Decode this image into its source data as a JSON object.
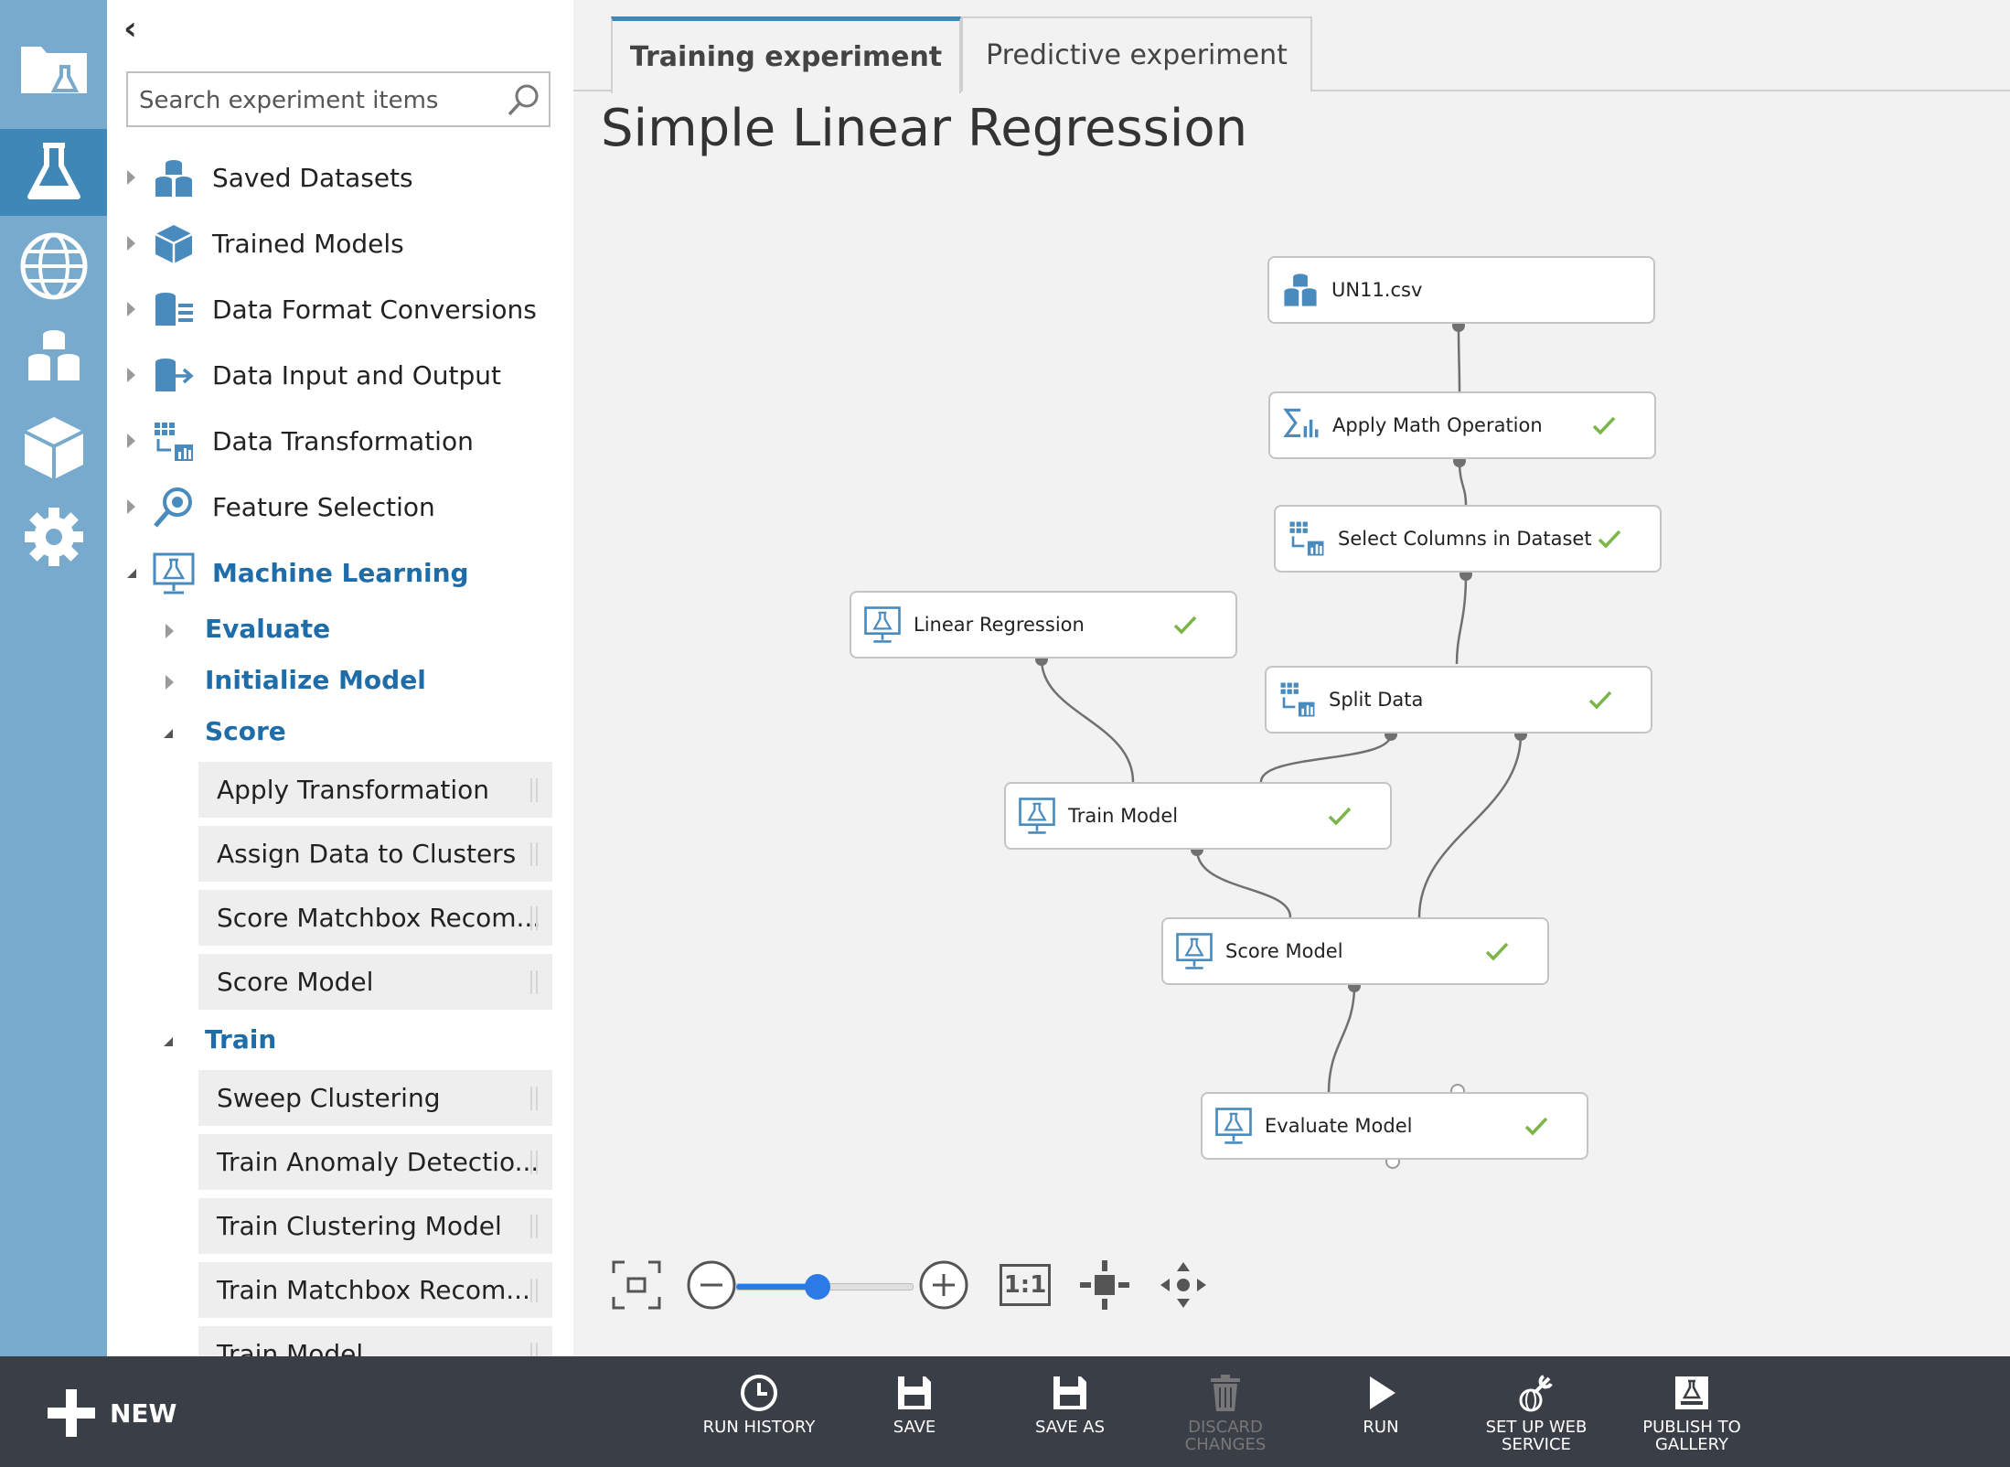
{
  "palette": {
    "collapse_glyph": "‹",
    "search": {
      "placeholder": "Search experiment items"
    },
    "categories": [
      {
        "label": "Saved Datasets",
        "icon": "dataset-icon"
      },
      {
        "label": "Trained Models",
        "icon": "cube-icon"
      },
      {
        "label": "Data Format Conversions",
        "icon": "format-conversion-icon"
      },
      {
        "label": "Data Input and Output",
        "icon": "data-io-icon"
      },
      {
        "label": "Data Transformation",
        "icon": "transformation-icon"
      },
      {
        "label": "Feature Selection",
        "icon": "feature-selection-icon"
      },
      {
        "label": "Machine Learning",
        "icon": "machine-learning-icon"
      }
    ],
    "ml_subcategories": {
      "evaluate": "Evaluate",
      "initialize": "Initialize Model",
      "score": "Score",
      "train": "Train"
    },
    "score_items": [
      "Apply Transformation",
      "Assign Data to Clusters",
      "Score Matchbox Recom...",
      "Score Model"
    ],
    "train_items": [
      "Sweep Clustering",
      "Train Anomaly Detectio...",
      "Train Clustering Model",
      "Train Matchbox Recom...",
      "Train Model"
    ]
  },
  "tabs": [
    {
      "label": "Training experiment",
      "active": true
    },
    {
      "label": "Predictive experiment",
      "active": false
    }
  ],
  "experiment": {
    "title": "Simple Linear Regression",
    "nodes": [
      {
        "id": "un11",
        "label": "UN11.csv",
        "icon": "dataset-icon",
        "complete": false
      },
      {
        "id": "math",
        "label": "Apply Math Operation",
        "icon": "math-operation-icon",
        "complete": true
      },
      {
        "id": "select",
        "label": "Select Columns in Dataset",
        "icon": "transformation-icon",
        "complete": true
      },
      {
        "id": "linreg",
        "label": "Linear Regression",
        "icon": "machine-learning-icon",
        "complete": true
      },
      {
        "id": "split",
        "label": "Split Data",
        "icon": "transformation-icon",
        "complete": true
      },
      {
        "id": "train",
        "label": "Train Model",
        "icon": "machine-learning-icon",
        "complete": true
      },
      {
        "id": "score",
        "label": "Score Model",
        "icon": "machine-learning-icon",
        "complete": true
      },
      {
        "id": "evaluate",
        "label": "Evaluate Model",
        "icon": "machine-learning-icon",
        "complete": true
      }
    ],
    "edges": [
      [
        "un11",
        "math"
      ],
      [
        "math",
        "select"
      ],
      [
        "select",
        "split"
      ],
      [
        "linreg",
        "train"
      ],
      [
        "split",
        "train"
      ],
      [
        "train",
        "score"
      ],
      [
        "split",
        "score"
      ],
      [
        "score",
        "evaluate"
      ]
    ]
  },
  "zoom": {
    "level": 0.46,
    "actual_size_label": "1:1"
  },
  "commands": {
    "new_label": "NEW",
    "items": [
      {
        "label": "RUN HISTORY",
        "icon": "clock-icon",
        "enabled": true
      },
      {
        "label": "SAVE",
        "icon": "save-icon",
        "enabled": true
      },
      {
        "label": "SAVE AS",
        "icon": "save-as-icon",
        "enabled": true
      },
      {
        "label": "DISCARD CHANGES",
        "icon": "trash-icon",
        "enabled": false
      },
      {
        "label": "RUN",
        "icon": "play-icon",
        "enabled": true
      },
      {
        "label": "SET UP WEB SERVICE",
        "icon": "web-service-icon",
        "enabled": true
      },
      {
        "label": "PUBLISH TO GALLERY",
        "icon": "gallery-icon",
        "enabled": true
      }
    ]
  },
  "colors": {
    "rail": "#78aacd",
    "rail_active": "#3f87b7",
    "accent": "#1e6ca8",
    "check": "#7ab648",
    "command_bar": "#3a3f47",
    "zoom_slider": "#2c7ae6"
  }
}
